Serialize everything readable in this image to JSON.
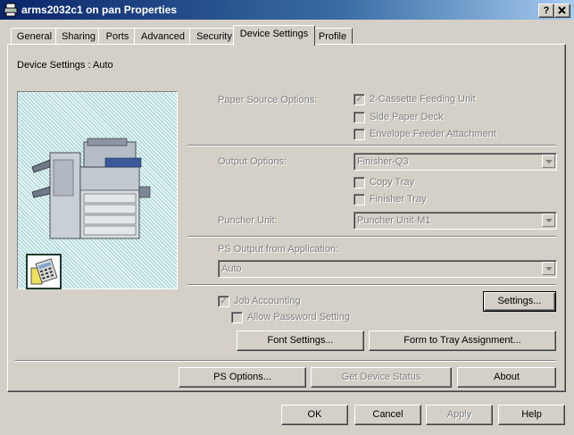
{
  "window": {
    "title": "arms2032c1 on pan Properties",
    "help_button": "?",
    "close_button": "X"
  },
  "tabs": [
    {
      "label": "General",
      "active": false
    },
    {
      "label": "Sharing",
      "active": false
    },
    {
      "label": "Ports",
      "active": false
    },
    {
      "label": "Advanced",
      "active": false
    },
    {
      "label": "Security",
      "active": false
    },
    {
      "label": "Device Settings",
      "active": true
    },
    {
      "label": "Profile",
      "active": false
    }
  ],
  "device_settings": {
    "label": "Device Settings : Auto"
  },
  "paper_source": {
    "label": "Paper Source Options:",
    "options": [
      {
        "label": "2-Cassette Feeding Unit",
        "checked": true
      },
      {
        "label": "Side Paper Deck",
        "checked": false
      },
      {
        "label": "Envelope Feeder Attachment",
        "checked": false
      }
    ]
  },
  "output": {
    "label": "Output Options:",
    "value": "Finisher-Q3",
    "options": [
      {
        "label": "Copy Tray",
        "checked": false
      },
      {
        "label": "Finisher Tray",
        "checked": false
      }
    ]
  },
  "puncher": {
    "label": "Puncher Unit:",
    "value": "Puncher Unit-M1"
  },
  "ps_output": {
    "label": "PS Output from Application:",
    "value": "Auto"
  },
  "accounting": {
    "job_accounting": {
      "label": "Job Accounting",
      "checked": true
    },
    "allow_password": {
      "label": "Allow Password Setting",
      "checked": false
    },
    "settings_button": "Settings..."
  },
  "buttons": {
    "font_settings": "Font Settings...",
    "form_to_tray": "Form to Tray Assignment...",
    "ps_options": "PS Options...",
    "get_device_status": "Get Device Status",
    "about": "About",
    "ok": "OK",
    "cancel": "Cancel",
    "apply": "Apply",
    "help": "Help"
  },
  "colors": {
    "title_start": "#0a246a",
    "title_end": "#a6caf0",
    "face": "#d4d0c8",
    "disabled_text": "#808080"
  },
  "icons": {
    "title": "printer-icon",
    "device": "copier-illustration",
    "accounting": "calculator-icon"
  }
}
